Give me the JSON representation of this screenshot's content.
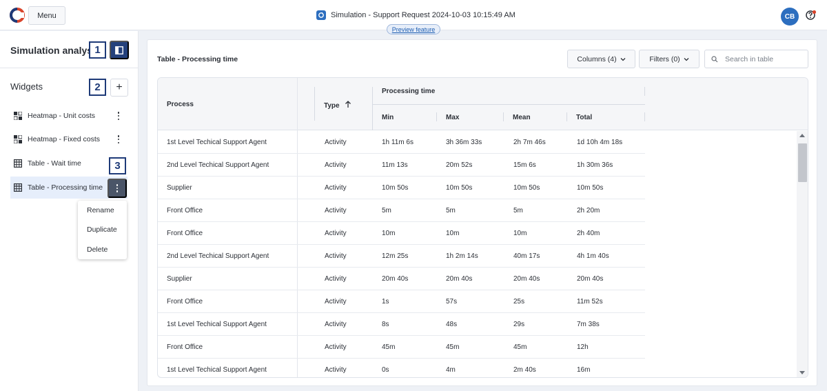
{
  "header": {
    "menu_label": "Menu",
    "title": "Simulation - Support Request 2024-10-03 10:15:49 AM",
    "preview_label": "Preview feature",
    "avatar_initials": "CB",
    "help_icon": "help-icon"
  },
  "sidebar": {
    "title": "Simulation analysis",
    "widgets_label": "Widgets",
    "add_label": "+",
    "callouts": [
      "1",
      "2",
      "3"
    ],
    "items": [
      {
        "label": "Heatmap - Unit costs",
        "icon": "heatmap-icon"
      },
      {
        "label": "Heatmap - Fixed costs",
        "icon": "heatmap-icon"
      },
      {
        "label": "Table - Wait time",
        "icon": "table-icon"
      },
      {
        "label": "Table - Processing time",
        "icon": "table-icon",
        "active": true
      }
    ],
    "context_menu": [
      "Rename",
      "Duplicate",
      "Delete"
    ]
  },
  "main": {
    "title": "Table - Processing time",
    "columns_button": "Columns (4)",
    "filters_button": "Filters (0)",
    "search_placeholder": "Search in table",
    "table": {
      "headers": {
        "process": "Process",
        "type": "Type",
        "group": "Processing time",
        "min": "Min",
        "max": "Max",
        "mean": "Mean",
        "total": "Total"
      },
      "sort": {
        "column": "Type",
        "direction": "ascending"
      },
      "rows": [
        [
          "1st Level Techical Support Agent",
          "Activity",
          "1h 11m 6s",
          "3h 36m 33s",
          "2h 7m 46s",
          "1d 10h 4m 18s"
        ],
        [
          "2nd Level Techical Support Agent",
          "Activity",
          "11m 13s",
          "20m 52s",
          "15m 6s",
          "1h 30m 36s"
        ],
        [
          "Supplier",
          "Activity",
          "10m 50s",
          "10m 50s",
          "10m 50s",
          "10m 50s"
        ],
        [
          "Front Office",
          "Activity",
          "5m",
          "5m",
          "5m",
          "2h 20m"
        ],
        [
          "Front Office",
          "Activity",
          "10m",
          "10m",
          "10m",
          "2h 40m"
        ],
        [
          "2nd Level Techical Support Agent",
          "Activity",
          "12m 25s",
          "1h 2m 14s",
          "40m 17s",
          "4h 1m 40s"
        ],
        [
          "Supplier",
          "Activity",
          "20m 40s",
          "20m 40s",
          "20m 40s",
          "20m 40s"
        ],
        [
          "Front Office",
          "Activity",
          "1s",
          "57s",
          "25s",
          "11m 52s"
        ],
        [
          "1st Level Techical Support Agent",
          "Activity",
          "8s",
          "48s",
          "29s",
          "7m 38s"
        ],
        [
          "Front Office",
          "Activity",
          "45m",
          "45m",
          "45m",
          "12h"
        ],
        [
          "1st Level Techical Support Agent",
          "Activity",
          "0s",
          "4m",
          "2m 40s",
          "16m"
        ]
      ]
    }
  },
  "colors": {
    "accent": "#2c6ebf",
    "dark_button": "#24417c",
    "callout_border": "#1e3a78",
    "active_item_bg": "#e6eefb"
  }
}
